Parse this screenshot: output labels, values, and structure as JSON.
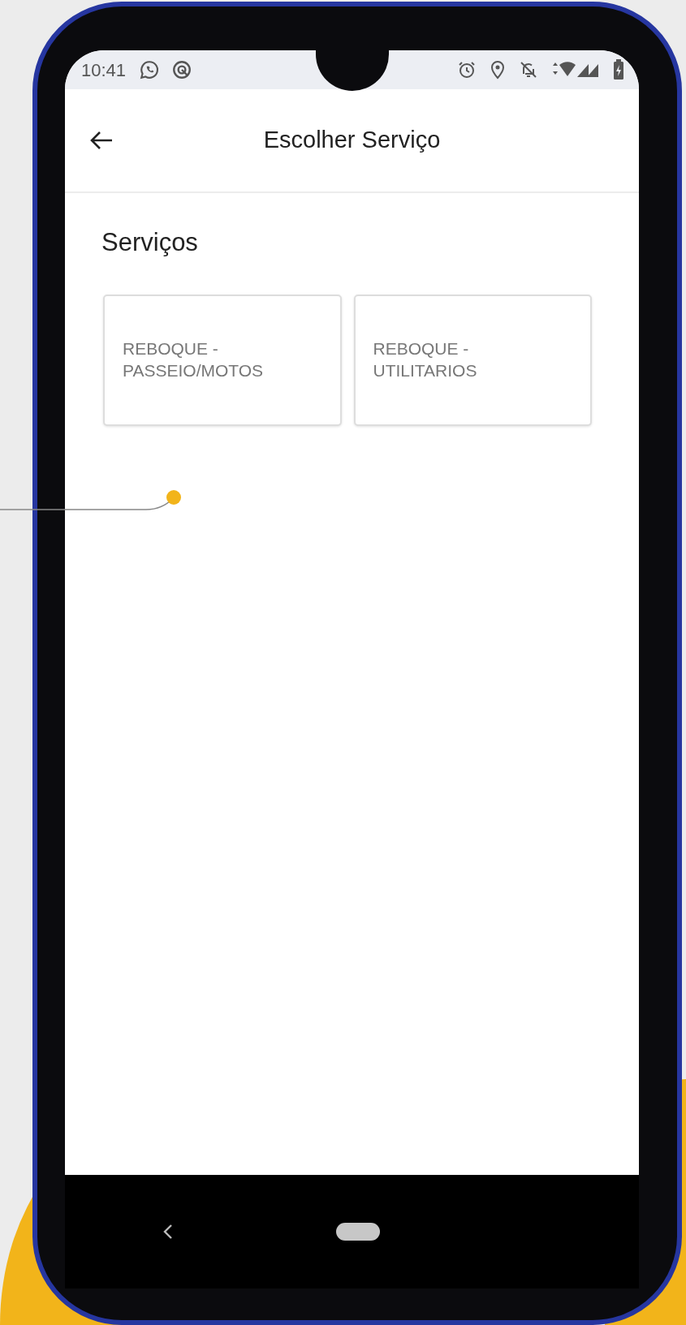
{
  "status_bar": {
    "time": "10:41"
  },
  "header": {
    "title": "Escolher Serviço"
  },
  "section_title": "Serviços",
  "services": [
    {
      "label": "REBOQUE -\nPASSEIO/MOTOS"
    },
    {
      "label": "REBOQUE -\nUTILITARIOS"
    }
  ]
}
